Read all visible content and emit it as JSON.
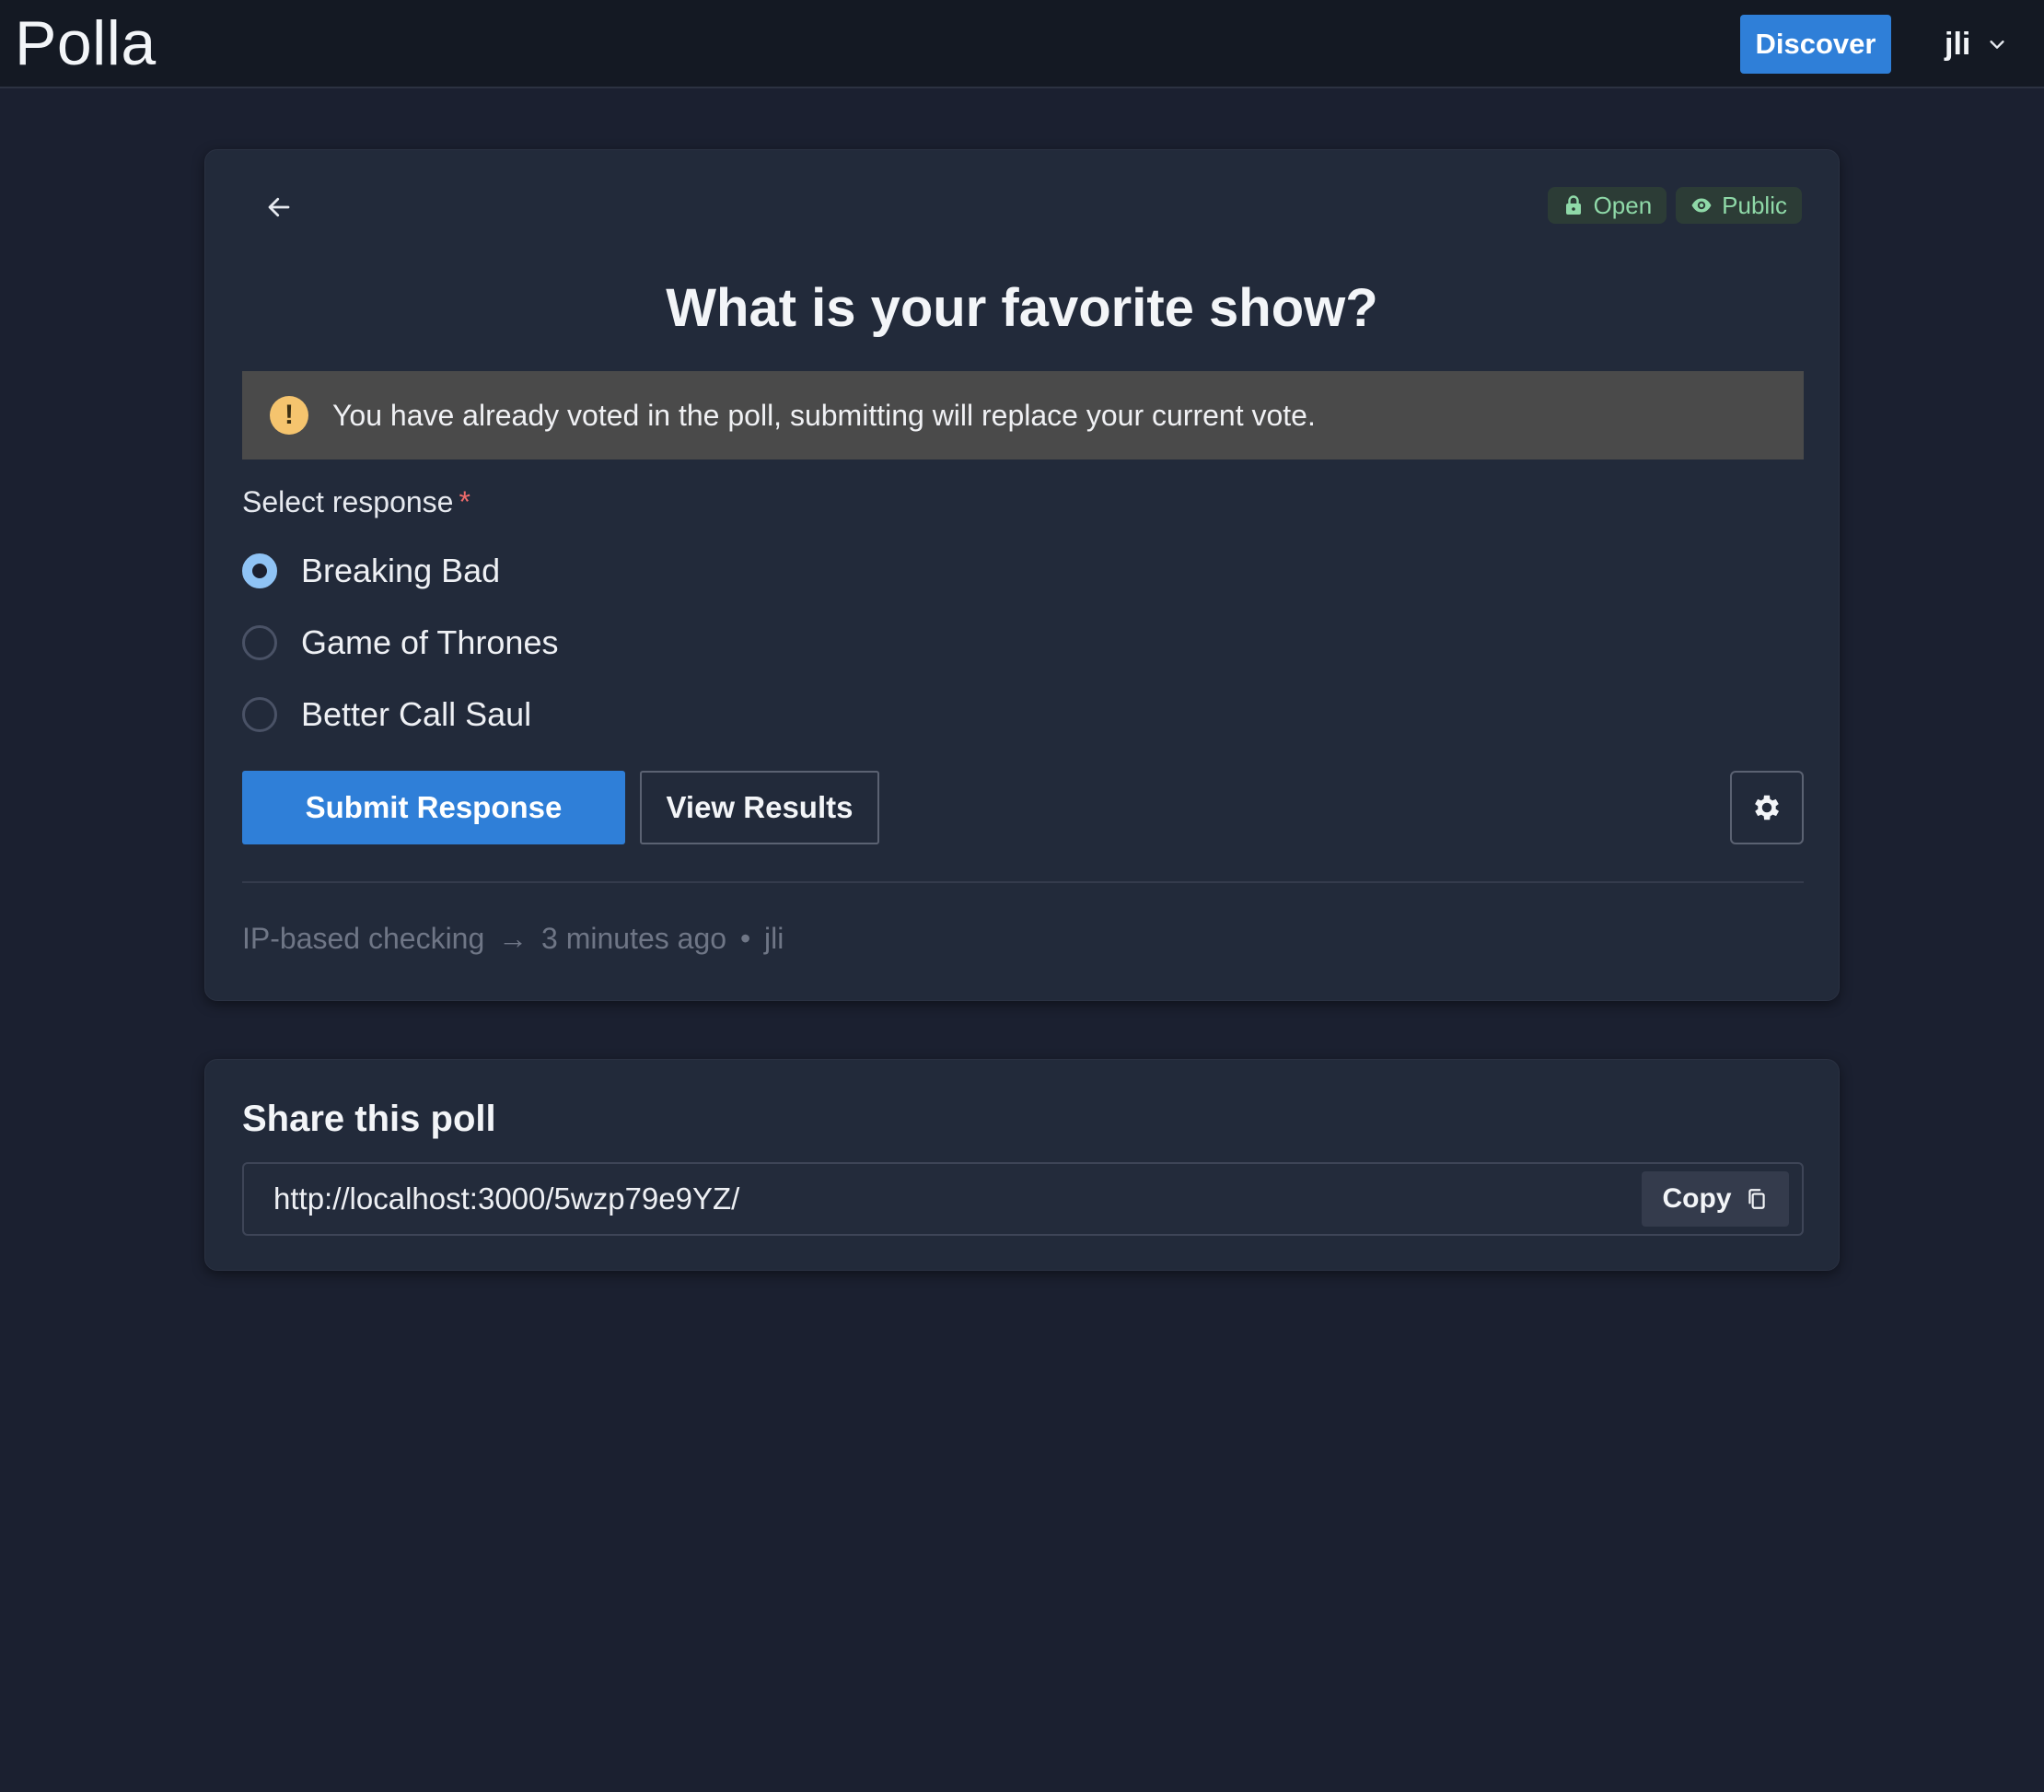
{
  "header": {
    "brand": "Polla",
    "discover_label": "Discover",
    "user_name": "jli"
  },
  "poll": {
    "badges": [
      {
        "label": "Open",
        "icon": "lock-icon"
      },
      {
        "label": "Public",
        "icon": "eye-icon"
      }
    ],
    "title": "What is your favorite show?",
    "notice": "You have already voted in the poll, submitting will replace your current vote.",
    "field_label": "Select response",
    "required_mark": "*",
    "options": [
      {
        "label": "Breaking Bad",
        "selected": true
      },
      {
        "label": "Game of Thrones",
        "selected": false
      },
      {
        "label": "Better Call Saul",
        "selected": false
      }
    ],
    "submit_label": "Submit Response",
    "results_label": "View Results",
    "meta": {
      "checking": "IP-based checking",
      "arrow": "→",
      "time": "3 minutes ago",
      "bullet": "•",
      "author": "jli"
    }
  },
  "share": {
    "title": "Share this poll",
    "url": "http://localhost:3000/5wzp79e9YZ/",
    "copy_label": "Copy"
  },
  "colors": {
    "accent": "#2f7fd8",
    "background": "#1b2030",
    "card": "#222a3a",
    "badge_text": "#8fd9a8",
    "warning": "#f5c46e",
    "required": "#ef6b6b"
  }
}
